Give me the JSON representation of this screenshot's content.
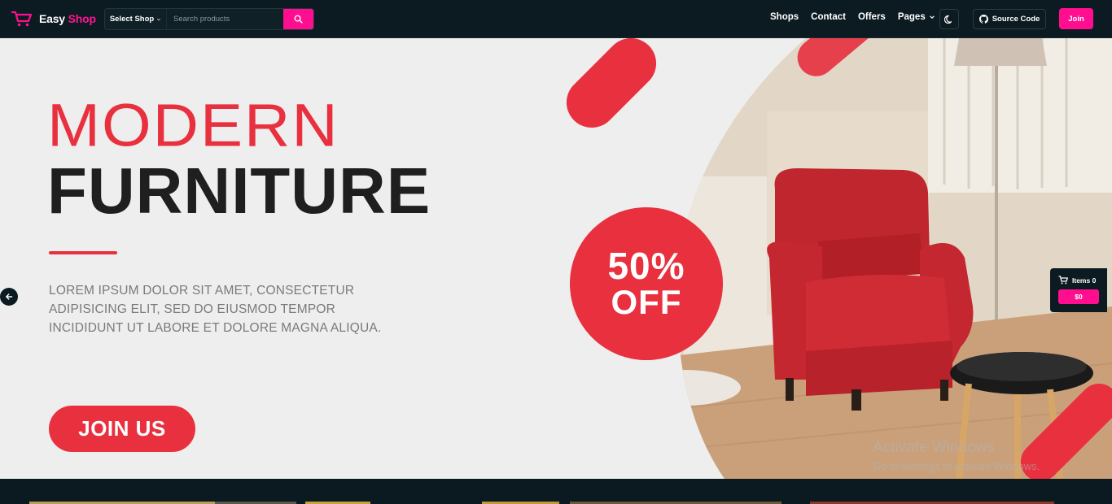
{
  "header": {
    "logo": {
      "easy": "Easy",
      "shop": "Shop"
    },
    "shop_select_label": "Select Shop",
    "search_placeholder": "Search products",
    "nav": [
      "Shops",
      "Contact",
      "Offers",
      "Pages"
    ],
    "source_code_label": "Source Code",
    "join_label": "Join"
  },
  "hero": {
    "title_line1": "MODERN",
    "title_line2": "FURNITURE",
    "description": "LOREM IPSUM DOLOR SIT AMET, CONSECTETUR ADIPISICING ELIT, SED DO EIUSMOD TEMPOR INCIDIDUNT UT LABORE ET DOLORE MAGNA ALIQUA.",
    "cta_label": "JOIN US",
    "discount_line1": "50%",
    "discount_line2": "OFF",
    "watermark_title": "Activate Windows",
    "watermark_sub": "Go to Settings to activate Windows."
  },
  "cart": {
    "items_label": "Items 0",
    "total": "$0"
  },
  "colors": {
    "brand_pink": "#ff0f8f",
    "hero_red": "#e8303f",
    "nav_bg": "#0c1b21"
  }
}
